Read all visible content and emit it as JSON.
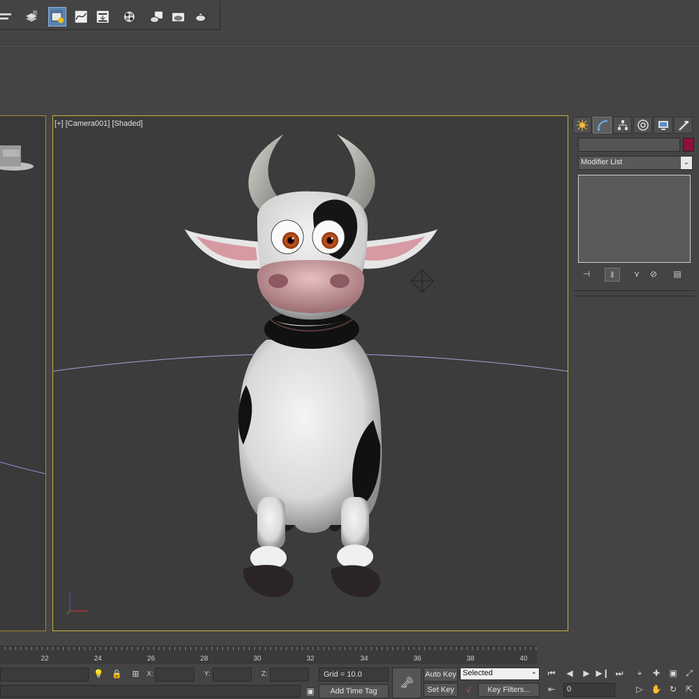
{
  "viewport": {
    "label": "[+] [Camera001] [Shaded]"
  },
  "command_panel": {
    "modifier_list": "Modifier List",
    "swatch_color": "#8a1238"
  },
  "timeline": {
    "ticks": [
      "22",
      "24",
      "26",
      "28",
      "30",
      "32",
      "34",
      "36",
      "38",
      "40"
    ]
  },
  "status": {
    "x_label": "X:",
    "y_label": "Y:",
    "z_label": "Z:",
    "grid": "Grid = 10.0",
    "add_time_tag": "Add Time Tag",
    "auto_key": "Auto Key",
    "set_key": "Set Key",
    "selected": "Selected",
    "key_filters": "Key Filters...",
    "frame": "0"
  },
  "icons": {
    "toolbar": [
      "align-icon",
      "layer-manager-icon",
      "scene-explorer-icon",
      "curve-editor-icon",
      "schematic-view-icon",
      "material-editor-icon",
      "render-setup-icon",
      "rendered-frame-icon",
      "render-teapot-icon"
    ],
    "panel_tabs": [
      "create-tab-icon",
      "modify-tab-icon",
      "hierarchy-tab-icon",
      "motion-tab-icon",
      "display-tab-icon",
      "utilities-tab-icon"
    ]
  }
}
